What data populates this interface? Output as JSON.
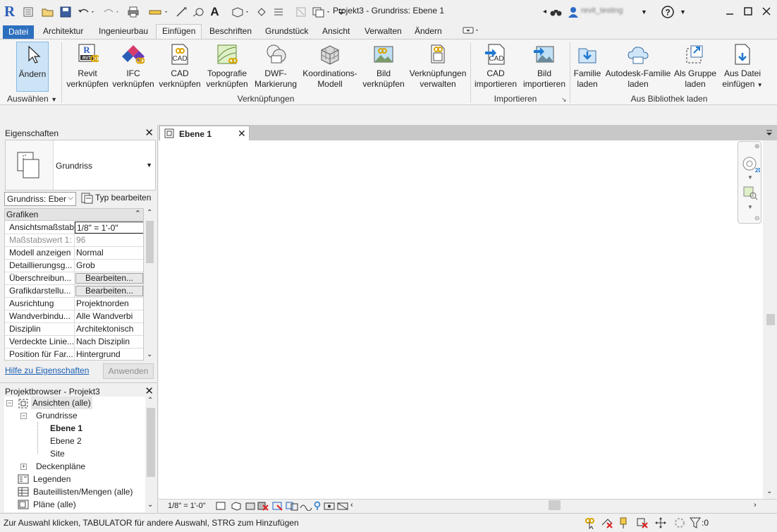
{
  "window": {
    "title": "Projekt3 - Grundriss: Ebene 1",
    "user": "revit_testing",
    "help_symbol": "?"
  },
  "ribbon_tabs": [
    {
      "label": "Datei"
    },
    {
      "label": "Architektur"
    },
    {
      "label": "Ingenieurbau"
    },
    {
      "label": "Einfügen"
    },
    {
      "label": "Beschriften"
    },
    {
      "label": "Grundstück"
    },
    {
      "label": "Ansicht"
    },
    {
      "label": "Verwalten"
    },
    {
      "label": "Ändern"
    }
  ],
  "ribbon": {
    "select": {
      "button": "Ändern",
      "panel": "Auswählen"
    },
    "link": {
      "panel": "Verknüpfungen",
      "buttons": [
        {
          "line1": "Revit",
          "line2": "verknüpfen"
        },
        {
          "line1": "IFC",
          "line2": "verknüpfen"
        },
        {
          "line1": "CAD",
          "line2": "verknüpfen"
        },
        {
          "line1": "Topografie",
          "line2": "verknüpfen"
        },
        {
          "line1": "DWF-",
          "line2": "Markierung"
        },
        {
          "line1": "Koordinations-",
          "line2": "Modell"
        },
        {
          "line1": "Bild",
          "line2": "verknüpfen"
        },
        {
          "line1": "Verknüpfungen",
          "line2": "verwalten"
        }
      ]
    },
    "import": {
      "panel": "Importieren",
      "buttons": [
        {
          "line1": "CAD",
          "line2": "importieren"
        },
        {
          "line1": "Bild",
          "line2": "importieren"
        }
      ]
    },
    "library": {
      "panel": "Aus Bibliothek laden",
      "buttons": [
        {
          "line1": "Familie",
          "line2": "laden"
        },
        {
          "line1": "Autodesk-Familie",
          "line2": "laden"
        },
        {
          "line1": "Als Gruppe",
          "line2": "laden"
        },
        {
          "line1": "Aus Datei",
          "line2": "einfügen"
        }
      ]
    }
  },
  "properties": {
    "title": "Eigenschaften",
    "type_name": "Grundriss",
    "instance_selector": "Grundriss: Eber",
    "edit_type": "Typ bearbeiten",
    "group": "Grafiken",
    "rows": [
      {
        "name": "Ansichtsmaßstab",
        "value": "1/8\" = 1'-0\""
      },
      {
        "name": "Maßstabswert 1:",
        "value": "96"
      },
      {
        "name": "Modell anzeigen",
        "value": "Normal"
      },
      {
        "name": "Detaillierungsg...",
        "value": "Grob"
      },
      {
        "name": "Überschreibun...",
        "value": "Bearbeiten..."
      },
      {
        "name": "Grafikdarstellu...",
        "value": "Bearbeiten..."
      },
      {
        "name": "Ausrichtung",
        "value": "Projektnorden"
      },
      {
        "name": "Wandverbindu...",
        "value": "Alle Wandverbi"
      },
      {
        "name": "Disziplin",
        "value": "Architektonisch"
      },
      {
        "name": "Verdeckte Linie...",
        "value": "Nach Disziplin"
      },
      {
        "name": "Position für Far...",
        "value": "Hintergrund"
      }
    ],
    "help_link": "Hilfe zu Eigenschaften",
    "apply": "Anwenden"
  },
  "browser": {
    "title": "Projektbrowser - Projekt3",
    "nodes": [
      {
        "label": "Ansichten (alle)"
      },
      {
        "label": "Grundrisse"
      },
      {
        "label": "Ebene 1"
      },
      {
        "label": "Ebene 2"
      },
      {
        "label": "Site"
      },
      {
        "label": "Deckenpläne"
      },
      {
        "label": "Legenden"
      },
      {
        "label": "Bauteillisten/Mengen (alle)"
      },
      {
        "label": "Pläne (alle)"
      }
    ]
  },
  "view": {
    "tab": "Ebene 1",
    "scale": "1/8\" = 1'-0\""
  },
  "status": {
    "text": "Zur Auswahl klicken, TABULATOR für andere Auswahl, STRG zum Hinzufügen",
    "filter_count": ":0"
  },
  "colors": {
    "accent": "#2d6fbf",
    "link": "#1a5fb4",
    "tab_strip": "#c8c8c8"
  }
}
